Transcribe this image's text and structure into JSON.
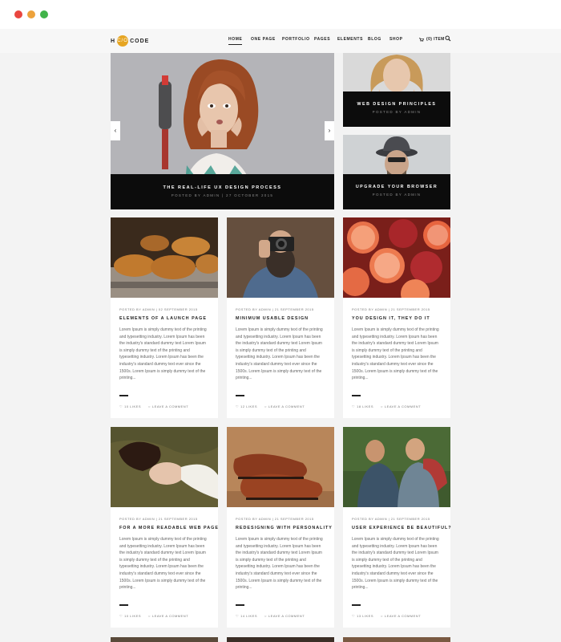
{
  "window": {
    "controls": [
      "close",
      "minimize",
      "maximize"
    ],
    "control_colors": {
      "close": "#e9463f",
      "minimize": "#eda23b",
      "maximize": "#41b34a"
    }
  },
  "brand": {
    "left": "H",
    "mark": "C/O",
    "right": "CODE",
    "accent": "#e6a522"
  },
  "nav": {
    "items": [
      "HOME",
      "ONE PAGE",
      "PORTFOLIO",
      "PAGES",
      "ELEMENTS",
      "BLOG",
      "SHOP"
    ],
    "active": "HOME"
  },
  "cart": {
    "label": "(0) ITEM",
    "icon": "cart-icon"
  },
  "search": {
    "icon": "search-icon"
  },
  "hero": {
    "main": {
      "title": "THE REAL-LIFE UX DESIGN PROCESS",
      "meta": "POSTED BY ADMIN | 27 OCTOBER 2015"
    },
    "prev_icon": "chevron-left-icon",
    "next_icon": "chevron-right-icon",
    "side": [
      {
        "title": "WEB DESIGN PRINCIPLES",
        "meta": "POSTED BY ADMIN"
      },
      {
        "title": "UPGRADE YOUR BROWSER",
        "meta": "POSTED BY ADMIN"
      }
    ]
  },
  "posts": [
    {
      "meta": "POSTED BY ADMIN | 02 SEPTEMBER 2015",
      "title": "ELEMENTS OF A LAUNCH PAGE",
      "excerpt": "Lorem Ipsum is simply dummy text of the printing and typesetting industry. Lorem Ipsum has been the industry's standard dummy text Lorem Ipsum is simply dummy text of the printing and typesetting industry. Lorem Ipsum has been the industry's standard dummy text ever since the 1500s. Lorem Ipsum is simply dummy text of the printing...",
      "likes": "10 LIKES",
      "comment": "LEAVE A COMMENT",
      "image": "croissants"
    },
    {
      "meta": "POSTED BY ADMIN | 21 SEPTEMBER 2015",
      "title": "MINIMUM USABLE DESIGN",
      "excerpt": "Lorem Ipsum is simply dummy text of the printing and typesetting industry. Lorem Ipsum has been the industry's standard dummy text Lorem Ipsum is simply dummy text of the printing and typesetting industry. Lorem Ipsum has been the industry's standard dummy text ever since the 1500s. Lorem Ipsum is simply dummy text of the printing...",
      "likes": "12 LIKES",
      "comment": "LEAVE A COMMENT",
      "image": "photographer"
    },
    {
      "meta": "POSTED BY ADMIN | 21 SEPTEMBER 2015",
      "title": "YOU DESIGN IT, THEY DO IT",
      "excerpt": "Lorem Ipsum is simply dummy text of the printing and typesetting industry. Lorem Ipsum has been the industry's standard dummy text Lorem Ipsum is simply dummy text of the printing and typesetting industry. Lorem Ipsum has been the industry's standard dummy text ever since the 1500s. Lorem Ipsum is simply dummy text of the printing...",
      "likes": "18 LIKES",
      "comment": "LEAVE A COMMENT",
      "image": "grapefruit"
    },
    {
      "meta": "POSTED BY ADMIN | 21 SEPTEMBER 2015",
      "title": "FOR A MORE READABLE WEB PAGE",
      "excerpt": "Lorem Ipsum is simply dummy text of the printing and typesetting industry. Lorem Ipsum has been the industry's standard dummy text Lorem Ipsum is simply dummy text of the printing and typesetting industry. Lorem Ipsum has been the industry's standard dummy text ever since the 1500s. Lorem Ipsum is simply dummy text of the printing...",
      "likes": "10 LIKES",
      "comment": "LEAVE A COMMENT",
      "image": "woman-grass"
    },
    {
      "meta": "POSTED BY ADMIN | 21 SEPTEMBER 2015",
      "title": "REDESIGNING WITH PERSONALITY",
      "excerpt": "Lorem Ipsum is simply dummy text of the printing and typesetting industry. Lorem Ipsum has been the industry's standard dummy text Lorem Ipsum is simply dummy text of the printing and typesetting industry. Lorem Ipsum has been the industry's standard dummy text ever since the 1500s. Lorem Ipsum is simply dummy text of the printing...",
      "likes": "14 LIKES",
      "comment": "LEAVE A COMMENT",
      "image": "shoes"
    },
    {
      "meta": "POSTED BY ADMIN | 21 SEPTEMBER 2015",
      "title": "USER EXPERIENCE BE BEAUTIFUL?",
      "excerpt": "Lorem Ipsum is simply dummy text of the printing and typesetting industry. Lorem Ipsum has been the industry's standard dummy text Lorem Ipsum is simply dummy text of the printing and typesetting industry. Lorem Ipsum has been the industry's standard dummy text ever since the 1500s. Lorem Ipsum is simply dummy text of the printing...",
      "likes": "13 LIKES",
      "comment": "LEAVE A COMMENT",
      "image": "couple"
    }
  ]
}
